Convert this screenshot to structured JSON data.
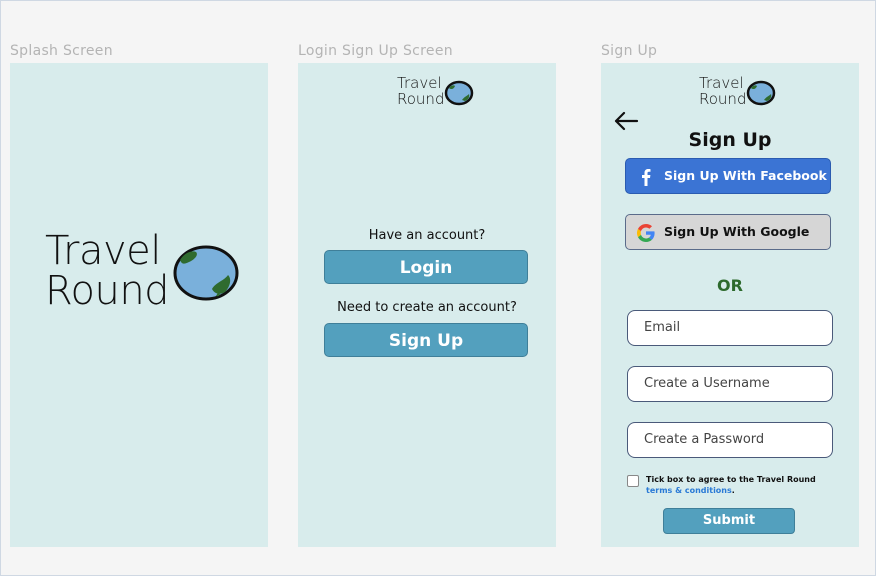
{
  "frames": {
    "splash": {
      "label": "Splash Screen"
    },
    "login": {
      "label": "Login Sign Up Screen"
    },
    "signup": {
      "label": "Sign Up"
    }
  },
  "logo": {
    "line1": "Travel",
    "line2": "Round"
  },
  "login_screen": {
    "have_account": "Have an account?",
    "login_button": "Login",
    "need_account": "Need to create an account?",
    "signup_button": "Sign Up"
  },
  "signup_screen": {
    "title": "Sign Up",
    "facebook_button": "Sign Up With Facebook",
    "google_button": "Sign Up With Google",
    "or": "OR",
    "email_placeholder": "Email",
    "username_placeholder": "Create a Username",
    "password_placeholder": "Create a Password",
    "terms_text": "Tick box to agree to the Travel Round",
    "terms_link": "terms & conditions",
    "terms_end": ".",
    "submit": "Submit"
  },
  "colors": {
    "frame_bg": "#d8ecec",
    "button_teal": "#53a0be",
    "facebook_blue": "#3b74d4",
    "or_green": "#2d6a2d"
  },
  "icons": [
    "globe-icon",
    "back-arrow-icon",
    "facebook-icon",
    "google-icon"
  ]
}
